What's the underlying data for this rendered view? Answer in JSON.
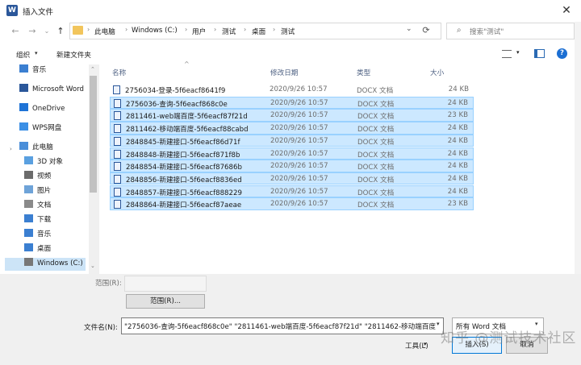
{
  "window": {
    "app_icon": "W",
    "title": "插入文件",
    "close": "✕"
  },
  "address": {
    "back": "←",
    "forward": "→",
    "recent": "⌄",
    "up": "↑",
    "crumbs": [
      "此电脑",
      "Windows (C:)",
      "用户",
      "测试",
      "桌面",
      "测试"
    ],
    "sep": "›",
    "history_drop": "⌄",
    "refresh": "⟳"
  },
  "search": {
    "icon": "⌕",
    "placeholder": "搜索\"测试\""
  },
  "toolbar": {
    "organize": "组织",
    "organize_arrow": "▾",
    "new_folder": "新建文件夹",
    "view_arrow": "▾",
    "help": "?"
  },
  "nav": [
    {
      "label": "音乐",
      "icon": "music-icon",
      "color": "#3b7fd1"
    },
    {
      "label": "Microsoft Word",
      "icon": "word-icon",
      "color": "#2b579a"
    },
    {
      "label": "OneDrive",
      "icon": "onedrive-icon",
      "color": "#1e73d6"
    },
    {
      "label": "WPS网盘",
      "icon": "cloud-icon",
      "color": "#3b8fe5"
    },
    {
      "label": "此电脑",
      "icon": "computer-icon",
      "color": "#4a8ed9"
    },
    {
      "label": "3D 对象",
      "icon": "cube-icon",
      "color": "#5aa0e0"
    },
    {
      "label": "视频",
      "icon": "video-icon",
      "color": "#6b6b6b"
    },
    {
      "label": "图片",
      "icon": "picture-icon",
      "color": "#6ea3d8"
    },
    {
      "label": "文档",
      "icon": "document-icon",
      "color": "#8a8a8a"
    },
    {
      "label": "下载",
      "icon": "download-icon",
      "color": "#3b7fd1"
    },
    {
      "label": "音乐",
      "icon": "music-icon",
      "color": "#3b7fd1"
    },
    {
      "label": "桌面",
      "icon": "desktop-icon",
      "color": "#3b7fd1"
    },
    {
      "label": "Windows (C:)",
      "icon": "drive-icon",
      "color": "#777777"
    }
  ],
  "columns": {
    "name": "名称",
    "date": "修改日期",
    "type": "类型",
    "size": "大小",
    "sort": "^"
  },
  "files": [
    {
      "name": "2756034-登录-5f6eacf8641f9",
      "date": "2020/9/26 10:57",
      "type": "DOCX 文档",
      "size": "24 KB",
      "selected": false
    },
    {
      "name": "2756036-查询-5f6eacf868c0e",
      "date": "2020/9/26 10:57",
      "type": "DOCX 文档",
      "size": "24 KB",
      "selected": true
    },
    {
      "name": "2811461-web端百度-5f6eacf87f21d",
      "date": "2020/9/26 10:57",
      "type": "DOCX 文档",
      "size": "23 KB",
      "selected": true
    },
    {
      "name": "2811462-移动端百度-5f6eacf88cabd",
      "date": "2020/9/26 10:57",
      "type": "DOCX 文档",
      "size": "24 KB",
      "selected": true
    },
    {
      "name": "2848845-新建接口-5f6eacf86d71f",
      "date": "2020/9/26 10:57",
      "type": "DOCX 文档",
      "size": "24 KB",
      "selected": true
    },
    {
      "name": "2848848-新建接口-5f6eacf871f8b",
      "date": "2020/9/26 10:57",
      "type": "DOCX 文档",
      "size": "24 KB",
      "selected": true
    },
    {
      "name": "2848854-新建接口-5f6eacf87686b",
      "date": "2020/9/26 10:57",
      "type": "DOCX 文档",
      "size": "24 KB",
      "selected": true
    },
    {
      "name": "2848856-新建接口-5f6eacf8836ed",
      "date": "2020/9/26 10:57",
      "type": "DOCX 文档",
      "size": "24 KB",
      "selected": true
    },
    {
      "name": "2848857-新建接口-5f6eacf888229",
      "date": "2020/9/26 10:57",
      "type": "DOCX 文档",
      "size": "24 KB",
      "selected": true
    },
    {
      "name": "2848864-新建接口-5f6eacf87aeae",
      "date": "2020/9/26 10:57",
      "type": "DOCX 文档",
      "size": "23 KB",
      "selected": true
    }
  ],
  "bottom": {
    "range_label": "范围(R):",
    "range_button": "范围(R)...",
    "filename_label": "文件名(N):",
    "filename_value": "\"2756036-查询-5f6eacf868c0e\" \"2811461-web端百度-5f6eacf87f21d\" \"2811462-移动端百度",
    "filename_drop": "▾",
    "filetype": "所有 Word 文档",
    "filetype_drop": "▾",
    "tools": "工具(L)",
    "tools_arrow": "▾",
    "insert": "插入(S)",
    "cancel": "取消"
  },
  "watermark": "知乎 @测试技术社区"
}
